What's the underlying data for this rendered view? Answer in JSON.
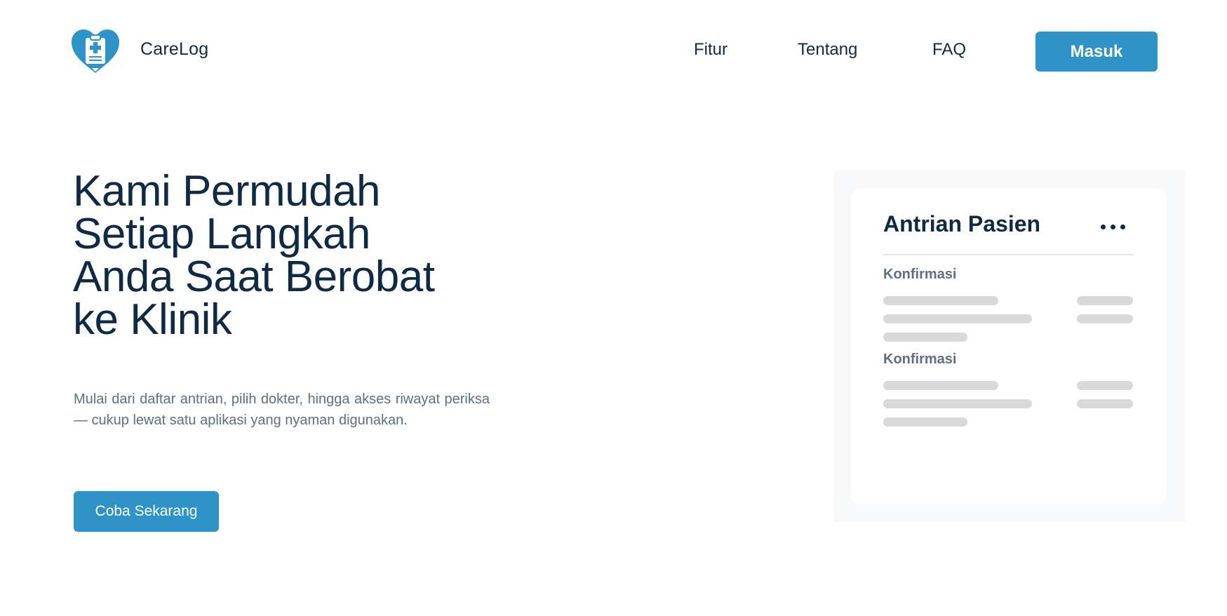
{
  "header": {
    "brand": "CareLog",
    "nav": {
      "fitur": "Fitur",
      "tentang": "Tentang",
      "faq": "FAQ"
    },
    "login_label": "Masuk"
  },
  "hero": {
    "title_lines": [
      "Kami Permudah",
      "Setiap Langkah",
      "Anda Saat Berobat",
      "ke Klinik"
    ],
    "description": "Mulai dari daftar antrian, pilih dokter, hingga akses riwayat periksa — cukup lewat satu aplikasi yang nyaman digunakan.",
    "cta_label": "Coba Sekarang"
  },
  "mockup": {
    "title": "Antrian Pasien",
    "sections": [
      {
        "label": "Konfirmasi"
      },
      {
        "label": "Konfirmasi"
      }
    ]
  },
  "colors": {
    "primary": "#2e94c8",
    "heading": "#0f2a44",
    "body_text": "#5d6f83",
    "skeleton": "#d9d9d9",
    "panel_bg": "#f7f8fa"
  },
  "icons": {
    "logo": "heart-clipboard-medical-icon",
    "more": "more-horizontal-icon"
  }
}
